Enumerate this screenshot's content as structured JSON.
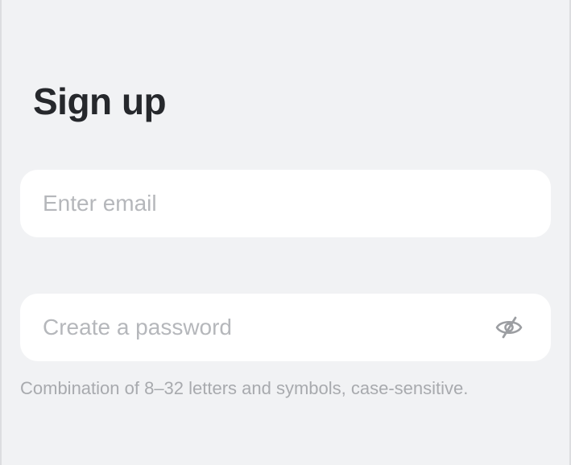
{
  "page": {
    "title": "Sign up"
  },
  "email": {
    "value": "",
    "placeholder": "Enter email"
  },
  "password": {
    "value": "",
    "placeholder": "Create a password",
    "toggle_icon": "eye-slash-icon",
    "hint": "Combination of 8–32 letters and symbols, case-sensitive."
  },
  "colors": {
    "background": "#f1f2f4",
    "field": "#ffffff",
    "title": "#26282c",
    "placeholder": "#b5b7bb",
    "hint": "#a8aaae"
  }
}
